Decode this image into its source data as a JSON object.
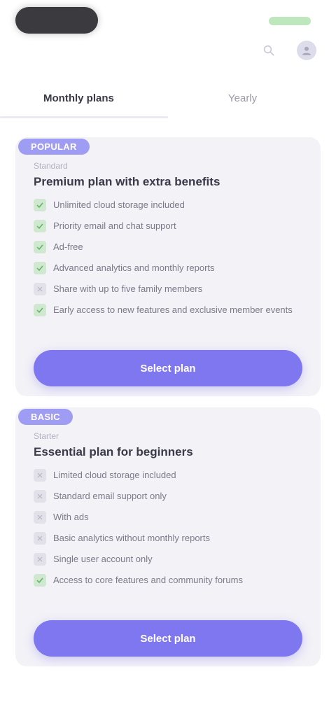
{
  "colors": {
    "accent": "#7e77f0",
    "badge": "#9f9cf3",
    "card_bg": "#f3f2f7",
    "check_on": "#cfe8cf",
    "check_off": "#e2e1ea"
  },
  "header": {
    "icons": [
      "search-icon",
      "profile-avatar-icon"
    ]
  },
  "tabs": [
    {
      "label": "Monthly plans",
      "active": true
    },
    {
      "label": "Yearly",
      "active": false
    }
  ],
  "plans": [
    {
      "badge": "POPULAR",
      "tag": "Standard",
      "title": "Premium plan with extra benefits",
      "features": [
        {
          "text": "Unlimited cloud storage included",
          "checked": true
        },
        {
          "text": "Priority email and chat support",
          "checked": true
        },
        {
          "text": "Ad-free",
          "checked": true
        },
        {
          "text": "Advanced analytics and monthly reports",
          "checked": true
        },
        {
          "text": "Share with up to five family members",
          "checked": false
        },
        {
          "text": "Early access to new features and exclusive member events",
          "checked": true
        }
      ],
      "button_label": "Select plan"
    },
    {
      "badge": "BASIC",
      "tag": "Starter",
      "title": "Essential plan for beginners",
      "features": [
        {
          "text": "Limited cloud storage included",
          "checked": false
        },
        {
          "text": "Standard email support only",
          "checked": false
        },
        {
          "text": "With ads",
          "checked": false
        },
        {
          "text": "Basic analytics without monthly reports",
          "checked": false
        },
        {
          "text": "Single user account only",
          "checked": false
        },
        {
          "text": "Access to core features and community forums",
          "checked": true
        }
      ],
      "button_label": "Select plan"
    }
  ]
}
